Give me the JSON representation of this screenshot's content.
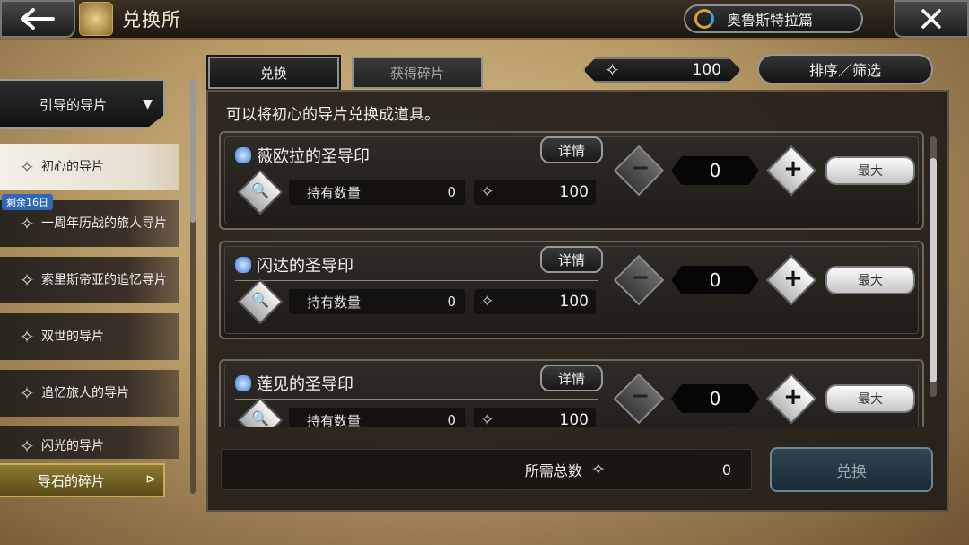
{
  "header": {
    "title": "兑换所",
    "chapter_label": "奥鲁斯特拉篇",
    "back_icon": "back-arrow-icon",
    "close_icon": "close-icon"
  },
  "tabs": [
    {
      "label": "兑换",
      "active": true
    },
    {
      "label": "获得碎片",
      "active": false
    }
  ],
  "currency": {
    "icon": "diamond-icon",
    "value": "100"
  },
  "sort_filter_label": "排序／筛选",
  "sidebar": {
    "dropdown_label": "引导的导片",
    "items": [
      {
        "label": "初心的导片",
        "active": true
      },
      {
        "label": "一周年历战的旅人导片",
        "badge": "剩余16日"
      },
      {
        "label": "索里斯帝亚的追忆导片"
      },
      {
        "label": "双世的导片"
      },
      {
        "label": "追忆旅人的导片"
      },
      {
        "label": "闪光的导片"
      }
    ],
    "bottom_label": "导石的碎片"
  },
  "main": {
    "description": "可以将初心的导片兑换成道具。",
    "detail_label": "详情",
    "owned_label": "持有数量",
    "max_label": "最大",
    "items": [
      {
        "name": "薇欧拉的圣导印",
        "owned": "0",
        "cost": "100",
        "qty": "0"
      },
      {
        "name": "闪达的圣导印",
        "owned": "0",
        "cost": "100",
        "qty": "0"
      },
      {
        "name": "莲见的圣导印",
        "owned": "0",
        "cost": "100",
        "qty": "0"
      }
    ],
    "total_label": "所需总数",
    "total_value": "0",
    "exchange_label": "兑换"
  },
  "colors": {
    "accent_blue": "#2f66b8",
    "exchange_button": "#2f4654",
    "panel_bg": "#221e1a"
  }
}
